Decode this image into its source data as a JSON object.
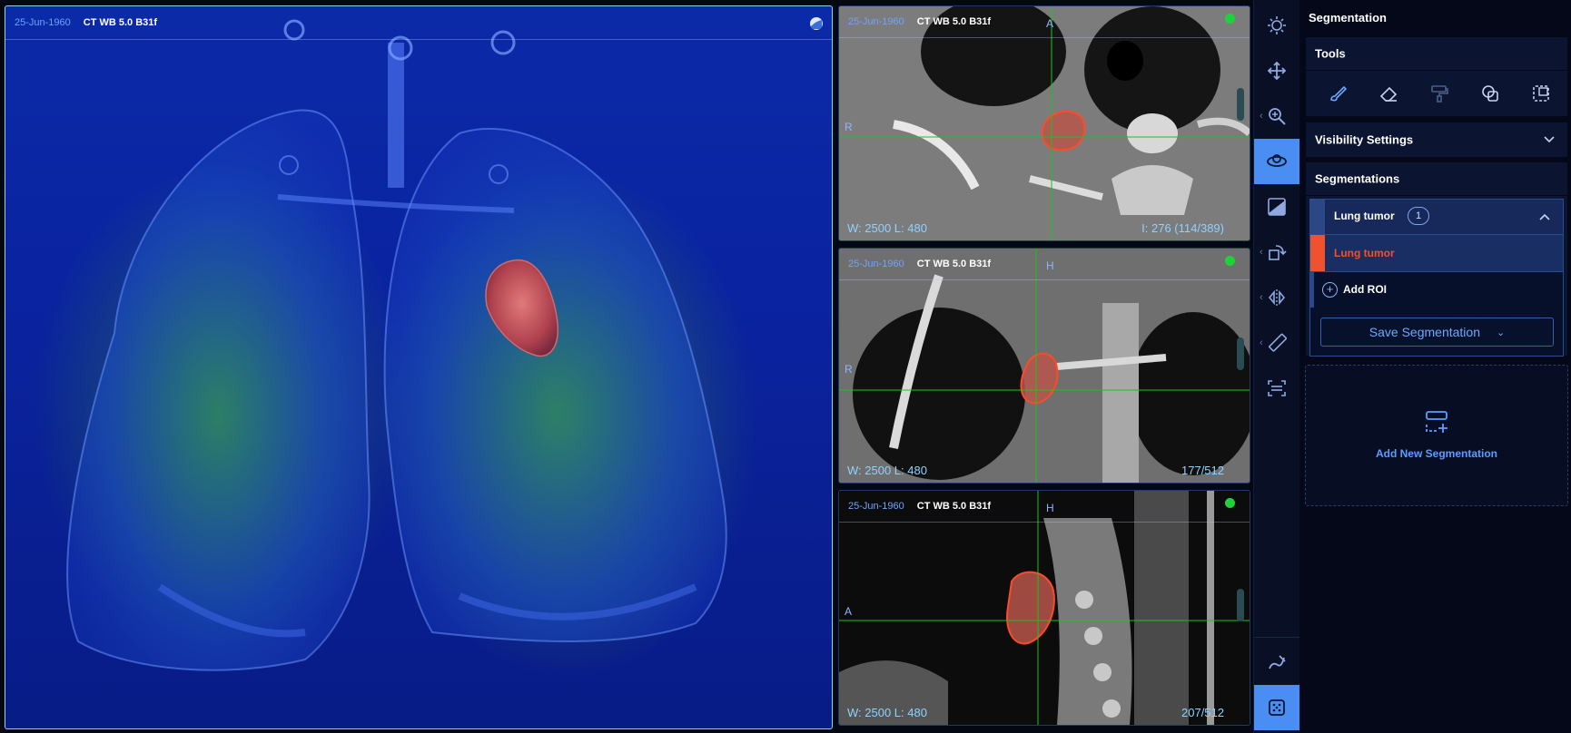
{
  "viewport3d": {
    "date": "25-Jun-1960",
    "series": "CT WB 5.0 B31f"
  },
  "viewports2d": [
    {
      "date": "25-Jun-1960",
      "series": "CT WB 5.0 B31f",
      "orient_top": "A",
      "orient_left": "R",
      "wl": "W:  2500   L:  480",
      "index": "I: 276 (114/389)"
    },
    {
      "date": "25-Jun-1960",
      "series": "CT WB 5.0 B31f",
      "orient_top": "H",
      "orient_left": "R",
      "wl": "W:  2500   L:  480",
      "index": "177/512"
    },
    {
      "date": "25-Jun-1960",
      "series": "CT WB 5.0 B31f",
      "orient_top": "H",
      "orient_left": "A",
      "wl": "W:  2500   L:  480",
      "index": "207/512"
    }
  ],
  "toolbar": {
    "tools": [
      "brightness-icon",
      "pan-icon",
      "zoom-icon",
      "3d-rotate-icon",
      "window-level-icon",
      "rotate-icon",
      "flip-icon",
      "measure-ruler-icon",
      "crosshair-icon",
      "annotate-icon",
      "segmentation-icon"
    ],
    "active": [
      "3d-rotate-icon",
      "segmentation-icon"
    ]
  },
  "panel": {
    "title": "Segmentation",
    "tools_title": "Tools",
    "tools": [
      "brush-icon",
      "eraser-icon",
      "paint-fill-icon",
      "shapes-icon",
      "threshold-icon"
    ],
    "visibility_title": "Visibility Settings",
    "segmentations_title": "Segmentations",
    "segmentation_name": "Lung tumor",
    "segmentation_count": "1",
    "segment_label": "Lung tumor",
    "segment_color": "#f0512f",
    "add_roi": "Add ROI",
    "save_button": "Save Segmentation",
    "add_new": "Add New Segmentation"
  },
  "colors": {
    "accent": "#4a8ef3",
    "link": "#5c9dff",
    "segment": "#f0512f",
    "status_ok": "#1ed23a"
  }
}
